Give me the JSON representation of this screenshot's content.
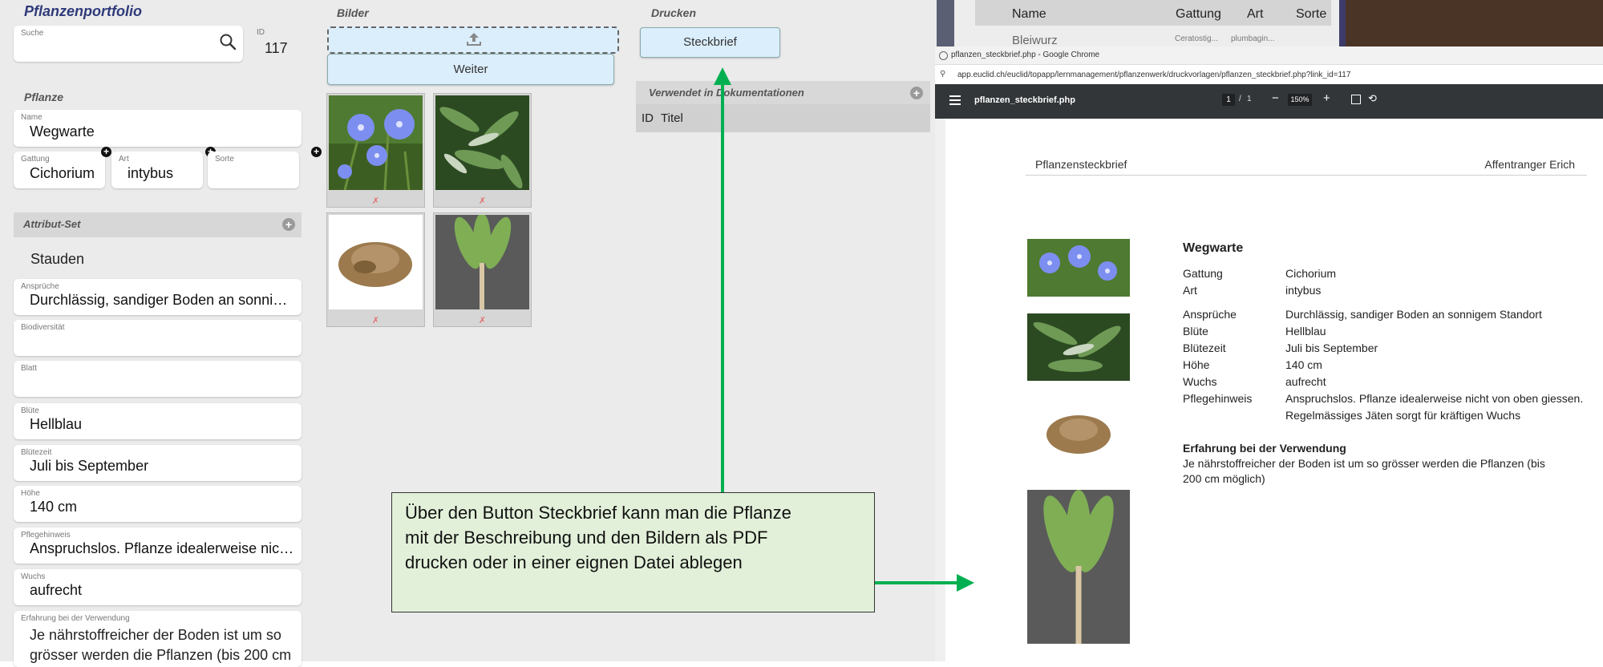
{
  "app": {
    "title": "Pflanzenportfolio",
    "search": {
      "label": "Suche",
      "value": ""
    },
    "id": {
      "label": "ID",
      "value": "117"
    },
    "plant_section": "Pflanze",
    "name": {
      "label": "Name",
      "value": "Wegwarte"
    },
    "gattung": {
      "label": "Gattung",
      "value": "Cichorium"
    },
    "art": {
      "label": "Art",
      "value": "intybus"
    },
    "sorte": {
      "label": "Sorte",
      "value": ""
    },
    "attribut_set": {
      "title": "Attribut-Set",
      "value": "Stauden"
    },
    "fields": [
      {
        "label": "Ansprüche",
        "value": "Durchlässig, sandiger Boden an sonnige…"
      },
      {
        "label": "Biodiversität",
        "value": ""
      },
      {
        "label": "Blatt",
        "value": ""
      },
      {
        "label": "Blüte",
        "value": "Hellblau"
      },
      {
        "label": "Blütezeit",
        "value": "Juli bis September"
      },
      {
        "label": "Höhe",
        "value": "140 cm"
      },
      {
        "label": "Pflegehinweis",
        "value": "Anspruchslos. Pflanze idealerweise nich…"
      },
      {
        "label": "Wuchs",
        "value": "aufrecht"
      }
    ],
    "erfahrung": {
      "label": "Erfahrung bei der Verwendung",
      "value": "Je nährstoffreicher der Boden ist um so grösser werden die Pflanzen (bis 200 cm"
    },
    "bilder": {
      "title": "Bilder",
      "weiter": "Weiter",
      "delete_glyph": "✗"
    },
    "drucken": {
      "title": "Drucken",
      "button": "Steckbrief"
    },
    "verwendet": {
      "title": "Verwendet in Dokumentationen",
      "col_id": "ID",
      "col_titel": "Titel"
    }
  },
  "bg_table": {
    "headers": [
      "Name",
      "Gattung",
      "Art",
      "Sorte"
    ],
    "row1": [
      "Bleiwurz",
      "Ceratostig...",
      "plumbagin..."
    ]
  },
  "chrome": {
    "title": "pflanzen_steckbrief.php - Google Chrome",
    "url": "app.euclid.ch/euclid/topapp/lernmanagement/pflanzenwerk/druckvorlagen/pflanzen_steckbrief.php?link_id=117",
    "viewer": {
      "filename": "pflanzen_steckbrief.php",
      "page_current": "1",
      "page_sep": "/",
      "page_total": "1",
      "zoom": "150%",
      "minus": "−",
      "plus": "+"
    }
  },
  "pdf": {
    "header_left": "Pflanzensteckbrief",
    "header_right": "Affentranger Erich",
    "plant_name": "Wegwarte",
    "rows": [
      {
        "key": "Gattung",
        "value": "Cichorium"
      },
      {
        "key": "Art",
        "value": "intybus"
      },
      {
        "key": "Ansprüche",
        "value": "Durchlässig, sandiger Boden an sonnigem Standort"
      },
      {
        "key": "Blüte",
        "value": "Hellblau"
      },
      {
        "key": "Blütezeit",
        "value": "Juli bis September"
      },
      {
        "key": "Höhe",
        "value": "140 cm"
      },
      {
        "key": "Wuchs",
        "value": "aufrecht"
      },
      {
        "key": "Pflegehinweis",
        "value": "Anspruchslos. Pflanze idealerweise nicht von oben giessen.",
        "value2": "Regelmässiges Jäten sorgt für kräftigen Wuchs"
      }
    ],
    "erfahrung_title": "Erfahrung bei der Verwendung",
    "erfahrung_line1": "Je nährstoffreicher der Boden ist um so grösser werden die Pflanzen (bis",
    "erfahrung_line2": "200 cm möglich)"
  },
  "callout": {
    "line1": "Über den Button Steckbrief kann man die Pflanze",
    "line2": "mit der Beschreibung und den Bildern als PDF",
    "line3": "drucken oder in einer eignen Datei ablegen"
  },
  "colors": {
    "accent_arrow": "#00b050",
    "callout_bg": "#e2f0d9",
    "button_bg": "#dbeefc",
    "title_color": "#2f3a7a"
  }
}
